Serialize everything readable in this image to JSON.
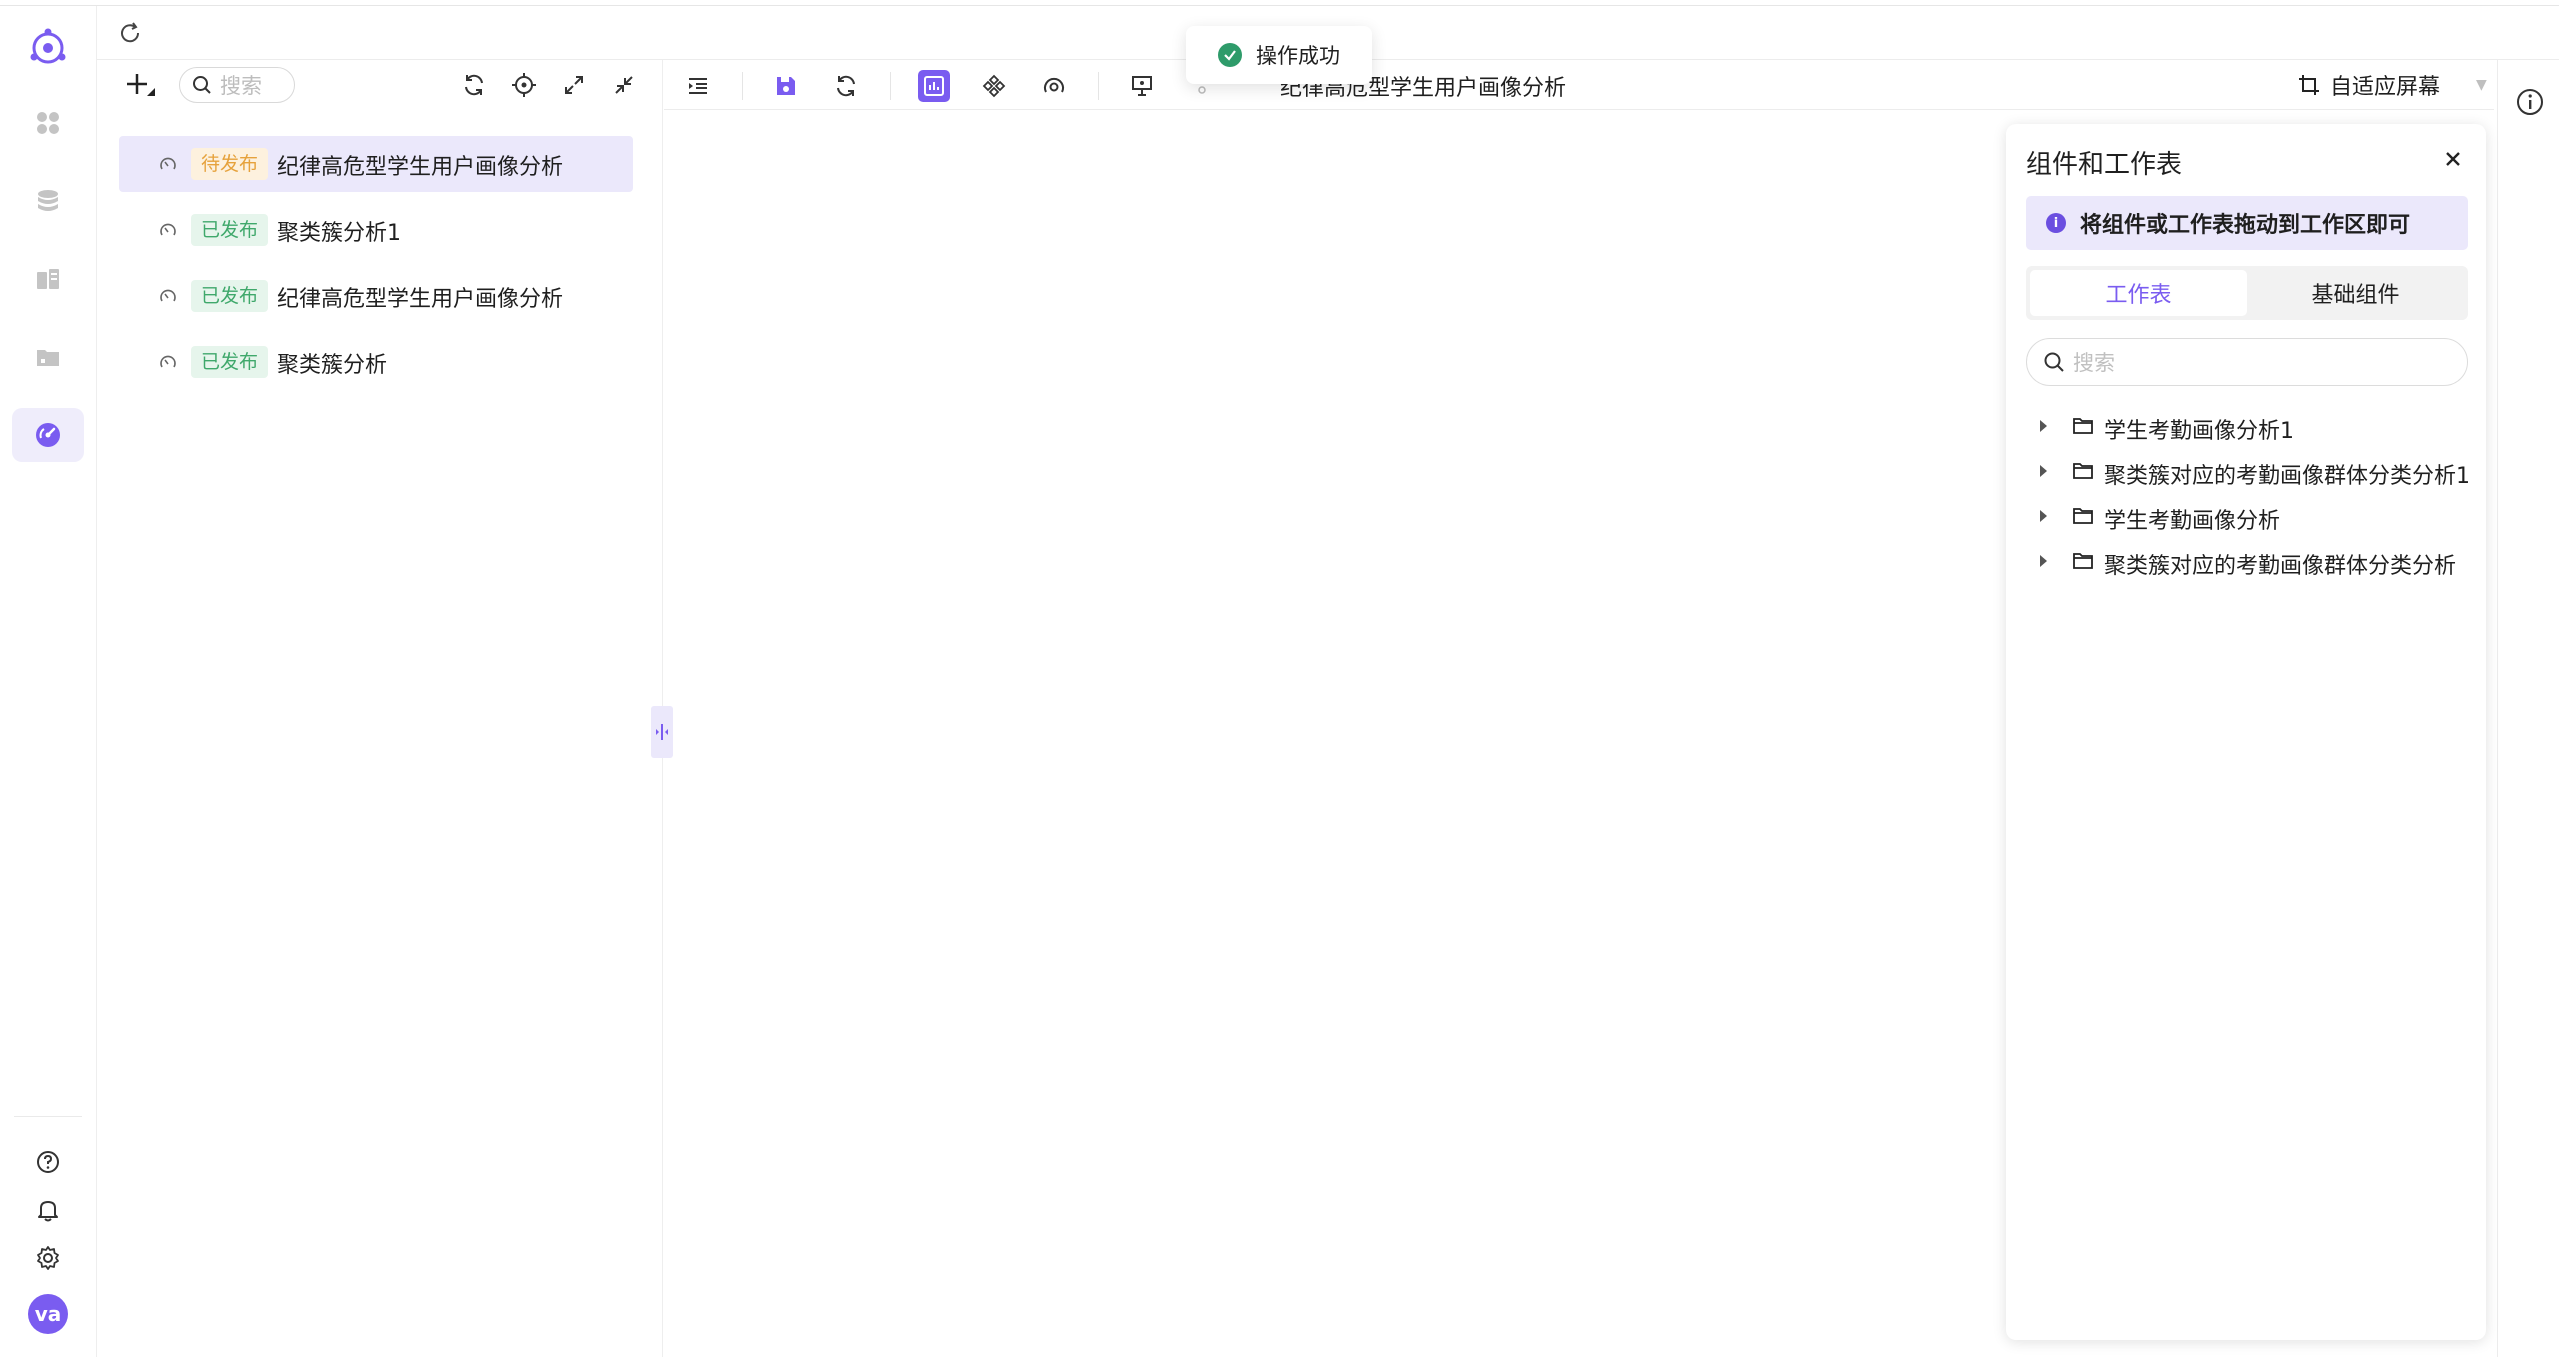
{
  "toast": {
    "message": "操作成功"
  },
  "tree": {
    "search_placeholder": "搜索",
    "items": [
      {
        "status": "待发布",
        "status_type": "pending",
        "label": "纪律高危型学生用户画像分析"
      },
      {
        "status": "已发布",
        "status_type": "published",
        "label": "聚类簇分析1"
      },
      {
        "status": "已发布",
        "status_type": "published",
        "label": "纪律高危型学生用户画像分析"
      },
      {
        "status": "已发布",
        "status_type": "published",
        "label": "聚类簇分析"
      }
    ]
  },
  "toolbar": {
    "doc_title": "纪律高危型学生用户画像分析",
    "fit_label": "自适应屏幕"
  },
  "panel": {
    "title": "组件和工作表",
    "hint": "将组件或工作表拖动到工作区即可",
    "tabs": [
      {
        "label": "工作表"
      },
      {
        "label": "基础组件"
      }
    ],
    "search_placeholder": "搜索",
    "folders": [
      {
        "name": "学生考勤画像分析1"
      },
      {
        "name": "聚类簇对应的考勤画像群体分类分析1"
      },
      {
        "name": "学生考勤画像分析"
      },
      {
        "name": "聚类簇对应的考勤画像群体分类分析"
      }
    ]
  },
  "user": {
    "avatar_text": "va"
  },
  "colors": {
    "accent": "#7a5cf0",
    "pending": "#e6a23c",
    "published": "#3fa86b",
    "success": "#2e9b6a"
  }
}
